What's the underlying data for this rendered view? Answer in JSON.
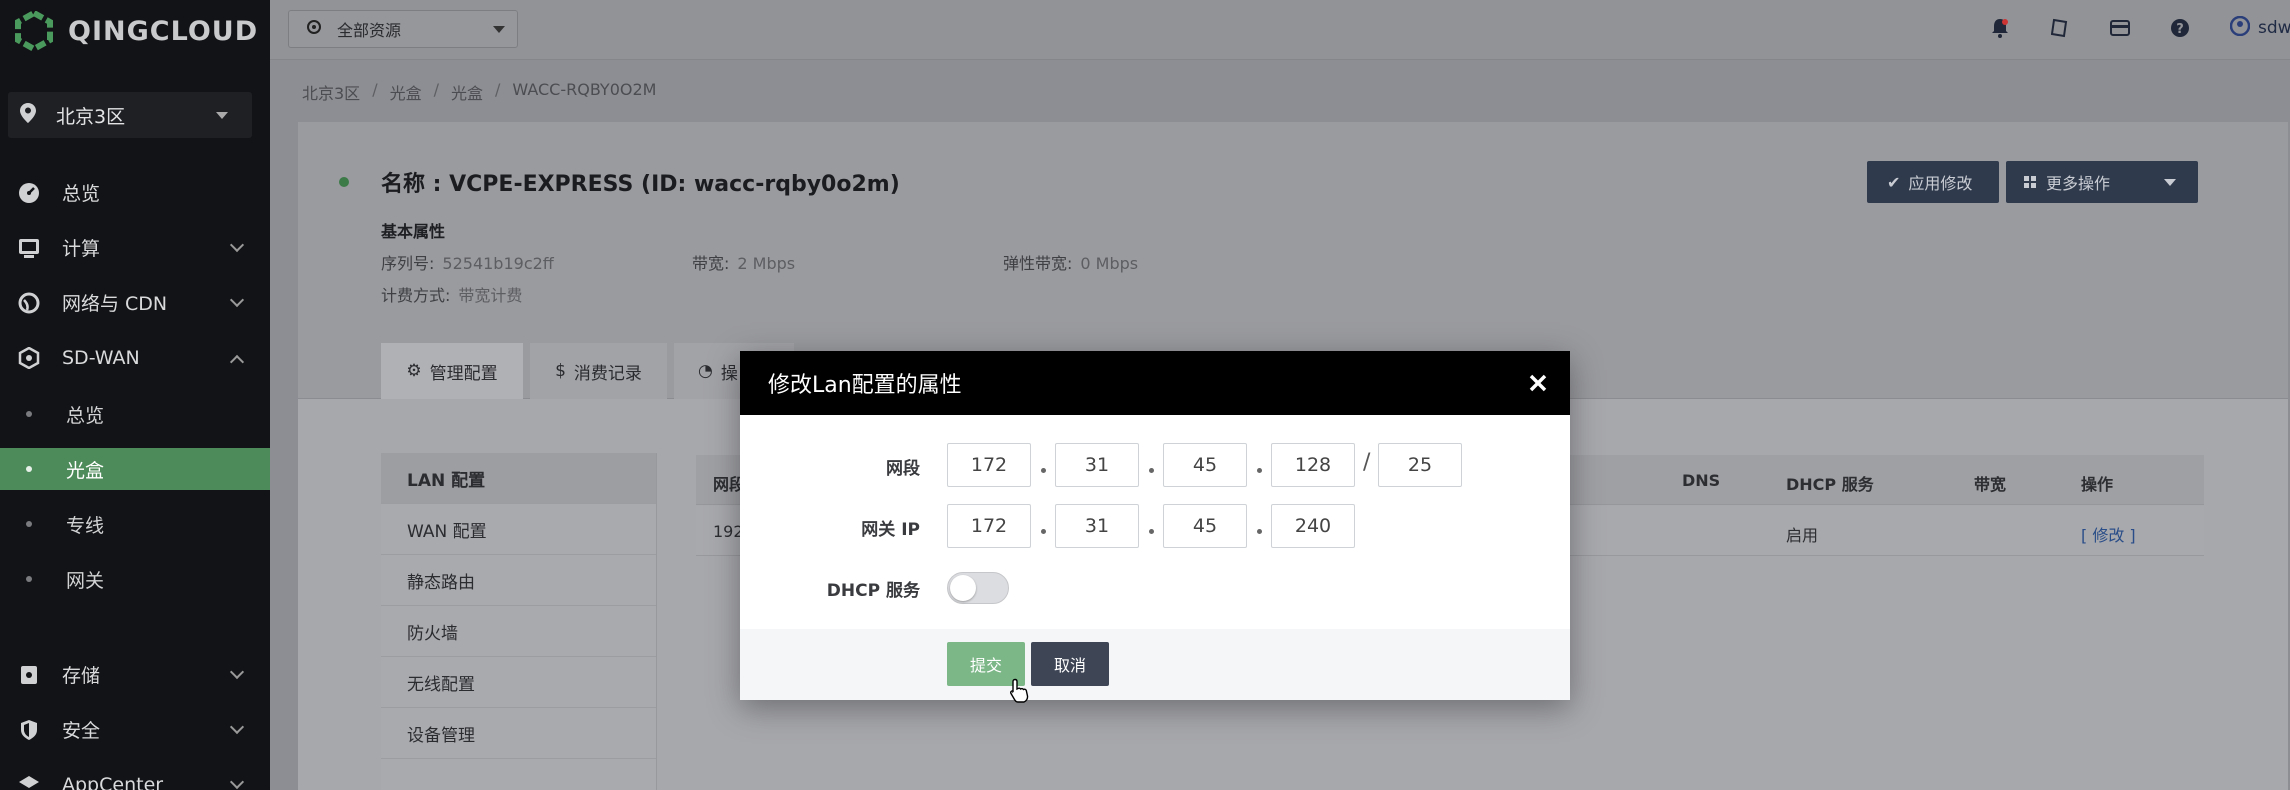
{
  "brand": {
    "name": "QINGCLOUD"
  },
  "sidebar": {
    "region": "北京3区",
    "items": [
      {
        "label": "总览",
        "icon": "dashboard-icon"
      },
      {
        "label": "计算",
        "icon": "monitor-icon"
      },
      {
        "label": "网络与 CDN",
        "icon": "globe-icon"
      },
      {
        "label": "SD-WAN",
        "icon": "hexagon-network-icon"
      }
    ],
    "sdwan_sub": [
      {
        "label": "总览"
      },
      {
        "label": "光盒"
      },
      {
        "label": "专线"
      },
      {
        "label": "网关"
      }
    ],
    "items_bottom": [
      {
        "label": "存储",
        "icon": "storage-icon"
      },
      {
        "label": "安全",
        "icon": "shield-icon"
      },
      {
        "label": "AppCenter",
        "icon": "layers-icon"
      }
    ],
    "active_color": "#4d8b5a"
  },
  "topbar": {
    "resource_select": "全部资源",
    "user": "sdwan"
  },
  "breadcrumb": [
    "北京3区",
    "光盒",
    "光盒",
    "WACC-RQBY0O2M"
  ],
  "detail": {
    "title": "名称 : VCPE-EXPRESS (ID: wacc-rqby0o2m)",
    "attr_heading": "基本属性",
    "serial_label": "序列号:",
    "serial_value": "52541b19c2ff",
    "bandwidth_label": "带宽:",
    "bandwidth_value": "2 Mbps",
    "elastic_label": "弹性带宽:",
    "elastic_value": "0 Mbps",
    "billing_label": "计费方式:",
    "billing_value": "带宽计费",
    "apply_button": "应用修改",
    "more_button": "更多操作"
  },
  "tabs": [
    {
      "label": "管理配置"
    },
    {
      "label": "消费记录"
    },
    {
      "label": "操"
    }
  ],
  "config_nav": [
    "LAN 配置",
    "WAN 配置",
    "静态路由",
    "防火墙",
    "无线配置",
    "设备管理"
  ],
  "table": {
    "headers": {
      "segment": "网段",
      "dns": "DNS",
      "dhcp": "DHCP 服务",
      "bandwidth": "带宽",
      "action": "操作"
    },
    "row": {
      "segment": "192",
      "dhcp": "启用",
      "action": "[ 修改 ]"
    }
  },
  "modal": {
    "title": "修改Lan配置的属性",
    "segment_label": "网段",
    "segment": [
      "172",
      "31",
      "45",
      "128"
    ],
    "mask": "25",
    "slash": "/",
    "gateway_label": "网关 IP",
    "gateway": [
      "172",
      "31",
      "45",
      "240"
    ],
    "dhcp_label": "DHCP 服务",
    "dhcp_enabled": false,
    "submit": "提交",
    "cancel": "取消"
  }
}
